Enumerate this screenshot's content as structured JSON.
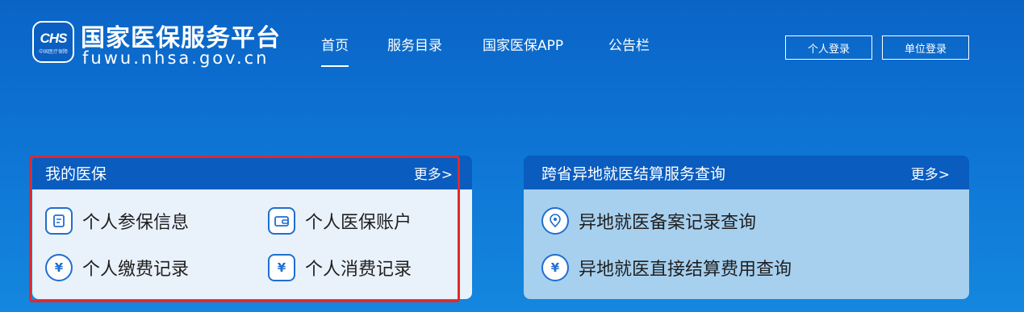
{
  "logo": {
    "badge_text": "CHS",
    "badge_subtext": "中国医疗保障",
    "title": "国家医保服务平台",
    "domain": "fuwu.nhsa.gov.cn"
  },
  "nav": {
    "items": [
      {
        "label": "首页",
        "active": true
      },
      {
        "label": "服务目录",
        "active": false
      },
      {
        "label": "国家医保APP",
        "active": false
      },
      {
        "label": "公告栏",
        "active": false
      }
    ]
  },
  "auth": {
    "personal_login": "个人登录",
    "org_login": "单位登录"
  },
  "cards": [
    {
      "title": "我的医保",
      "more": "更多>",
      "items": [
        {
          "label": "个人参保信息",
          "icon": "document-icon"
        },
        {
          "label": "个人医保账户",
          "icon": "wallet-icon"
        },
        {
          "label": "个人缴费记录",
          "icon": "payment-hand-icon"
        },
        {
          "label": "个人消费记录",
          "icon": "receipt-yuan-icon"
        }
      ]
    },
    {
      "title": "跨省异地就医结算服务查询",
      "more": "更多>",
      "items": [
        {
          "label": "异地就医备案记录查询",
          "icon": "location-heart-icon"
        },
        {
          "label": "异地就医直接结算费用查询",
          "icon": "yuan-coin-icon"
        }
      ]
    }
  ],
  "colors": {
    "header_bg": "#0a64c6",
    "card_head": "#0a5cbf",
    "card1_body": "#e9f1fb",
    "card2_body": "#a7d0ef",
    "icon_blue": "#1f6fd0",
    "highlight": "#e0292a"
  }
}
